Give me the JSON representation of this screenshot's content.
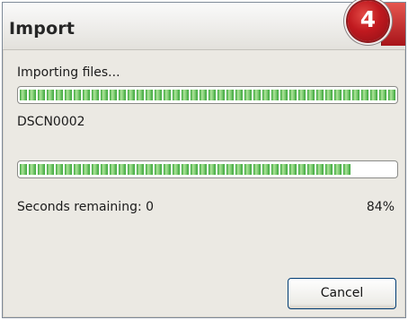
{
  "window": {
    "title": "Import",
    "step_badge": "4"
  },
  "overall": {
    "label": "Importing files...",
    "progress_fraction": 1.0
  },
  "current_file": {
    "name": "DSCN0002",
    "progress_fraction": 0.88
  },
  "status": {
    "seconds_remaining": "Seconds remaining: 0",
    "percent": "84%"
  },
  "buttons": {
    "cancel_label": "Cancel"
  },
  "colors": {
    "progress_green": "#3aa63a",
    "badge_red": "#c0191f"
  }
}
